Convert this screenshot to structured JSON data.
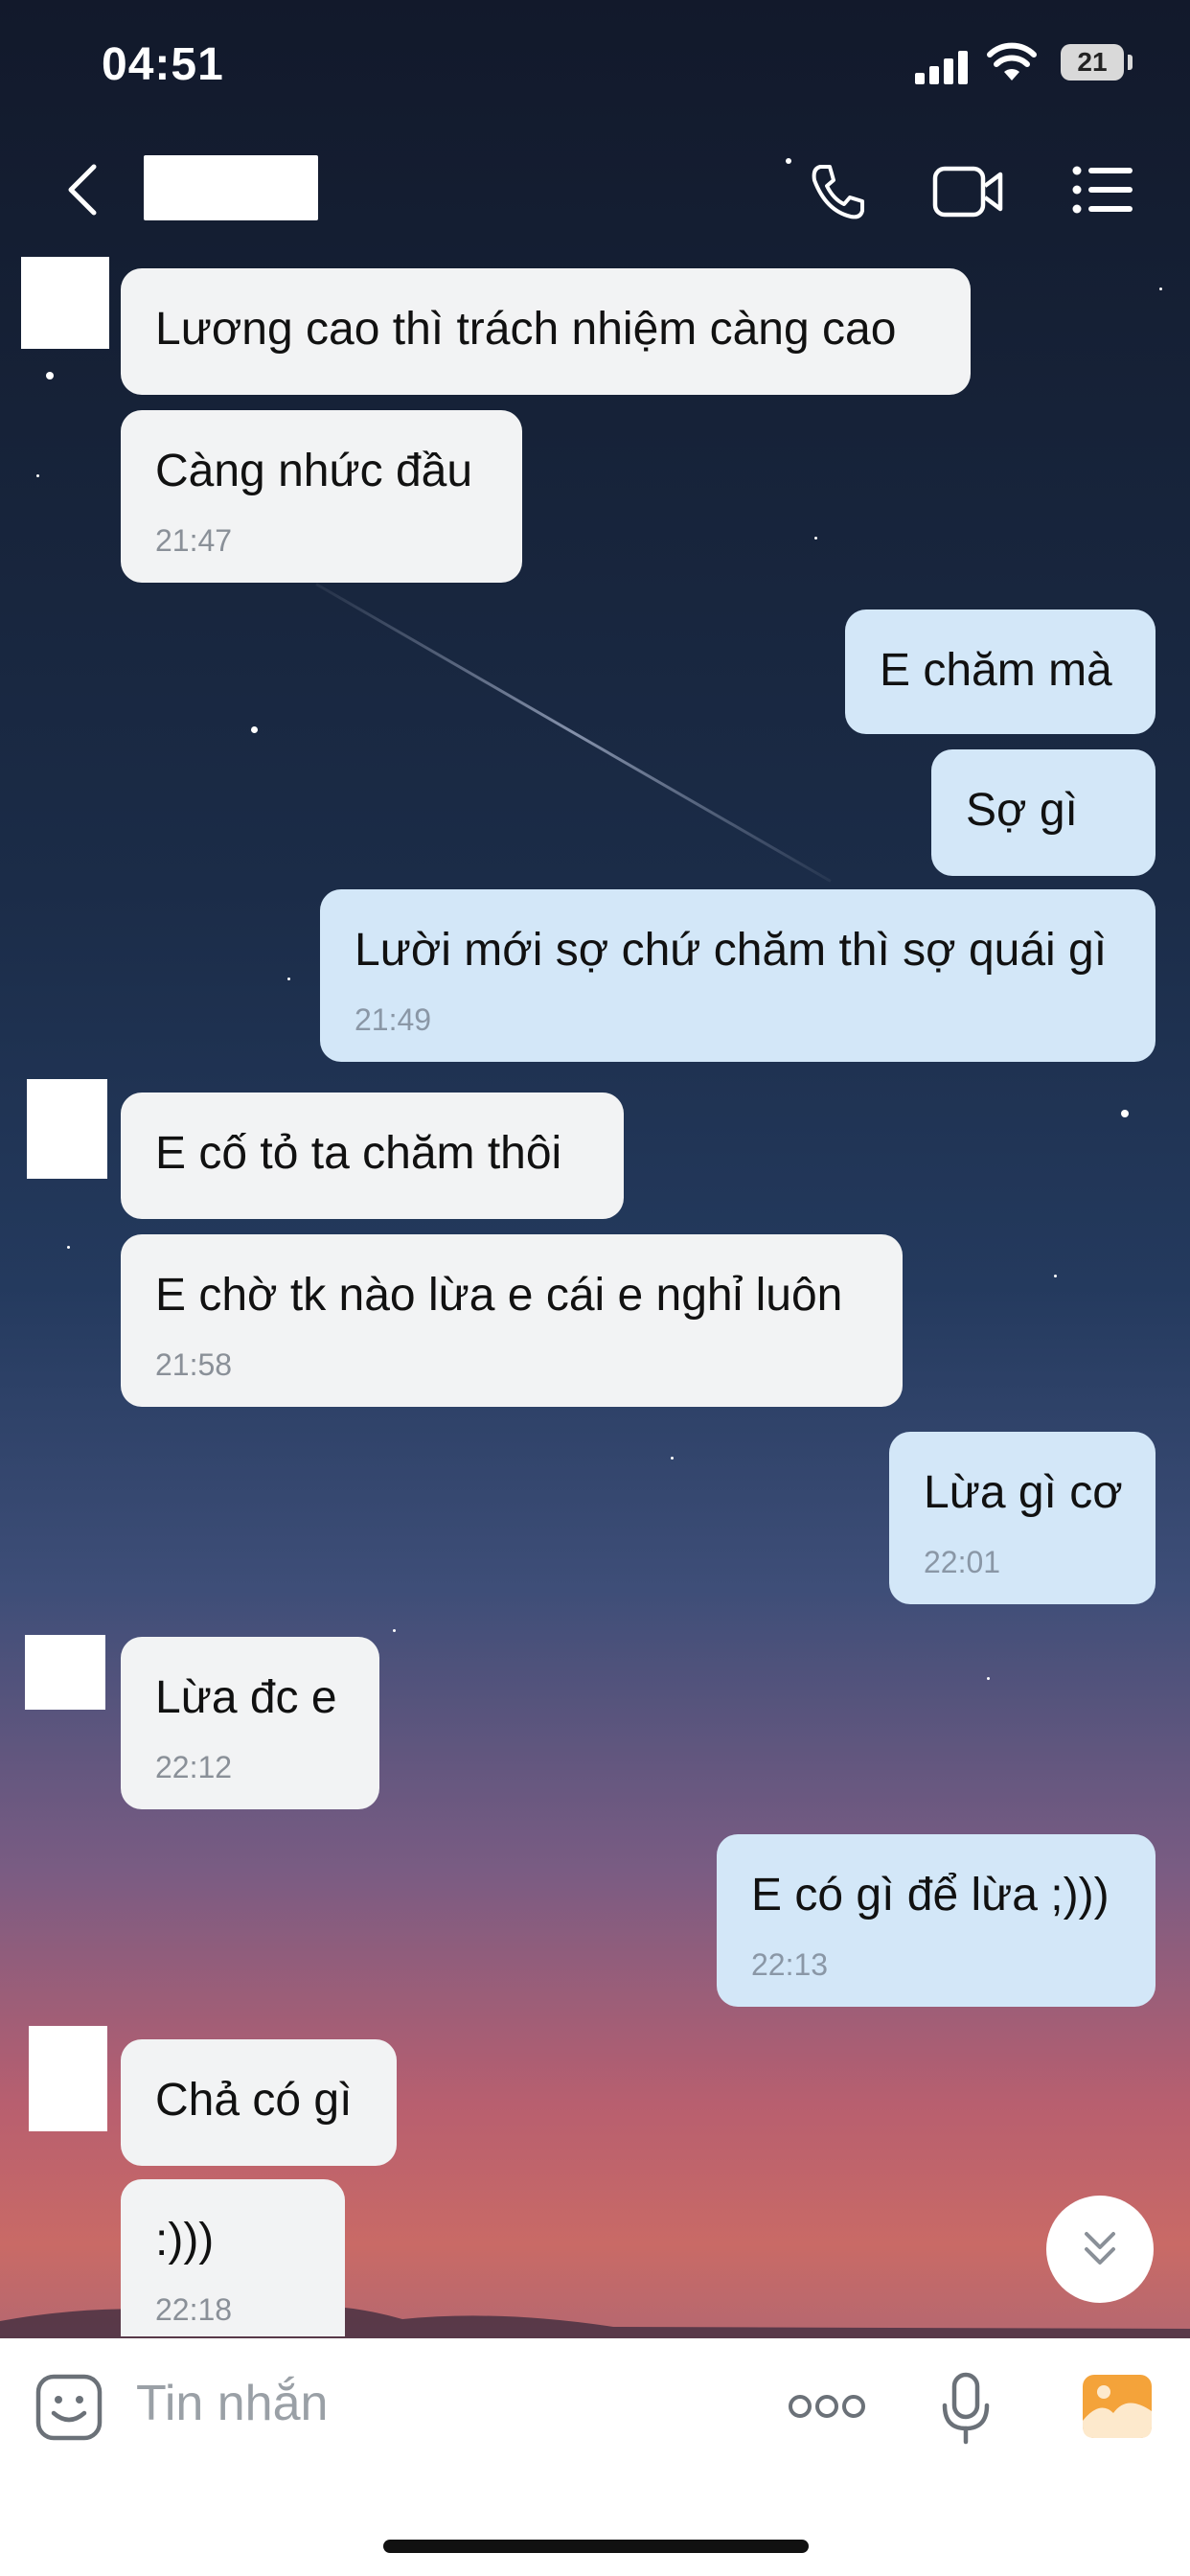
{
  "status_bar": {
    "time": "04:51",
    "battery": "21"
  },
  "header": {
    "contact_name": ""
  },
  "messages": [
    {
      "side": "in",
      "text": "Lương cao thì trách nhiệm càng cao",
      "time": ""
    },
    {
      "side": "in",
      "text": "Càng nhức đầu",
      "time": "21:47"
    },
    {
      "side": "out",
      "text": "E chăm mà",
      "time": ""
    },
    {
      "side": "out",
      "text": "Sợ gì",
      "time": ""
    },
    {
      "side": "out",
      "text": "Lười mới sợ chứ chăm thì sợ quái gì",
      "time": "21:49"
    },
    {
      "side": "in",
      "text": "E cố tỏ ta chăm thôi",
      "time": ""
    },
    {
      "side": "in",
      "text": "E chờ tk nào lừa e cái e nghỉ luôn",
      "time": "21:58"
    },
    {
      "side": "out",
      "text": "Lừa gì cơ",
      "time": "22:01"
    },
    {
      "side": "in",
      "text": "Lừa đc e",
      "time": "22:12"
    },
    {
      "side": "out",
      "text": "E có gì để lừa ;)))",
      "time": "22:13"
    },
    {
      "side": "in",
      "text": "Chả có gì",
      "time": ""
    },
    {
      "side": "in",
      "text": ":)))",
      "time": "22:18"
    }
  ],
  "input": {
    "placeholder": "Tin nhắn"
  },
  "icons": {
    "back": "chevron-left-icon",
    "call": "phone-icon",
    "video": "video-camera-icon",
    "menu": "list-menu-icon",
    "scroll_down": "double-chevron-down-icon",
    "sticker": "smiley-sticker-icon",
    "more": "more-dots-icon",
    "mic": "microphone-icon",
    "gallery": "image-gallery-icon"
  },
  "colors": {
    "incoming_bubble": "#f2f3f4",
    "outgoing_bubble": "#d3e7f8",
    "gallery_accent": "#f4a33a"
  }
}
